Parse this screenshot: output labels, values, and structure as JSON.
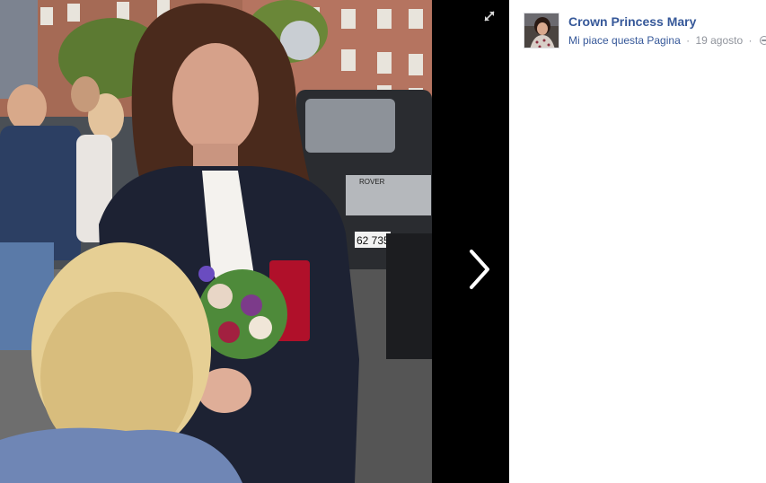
{
  "photo_viewer": {
    "image_description": "Photo",
    "expand_icon": "expand-arrows-icon",
    "next_icon": "chevron-right-icon",
    "license_plate_text": "62 735",
    "car_badge_text": "ROVER"
  },
  "post": {
    "page_name": "Crown Princess Mary",
    "like_label": "Mi piace questa Pagina",
    "separator": "·",
    "date": "19 agosto",
    "privacy_icon": "globe-icon"
  },
  "colors": {
    "link": "#365899",
    "meta": "#90949c",
    "viewer_bg": "#000000"
  }
}
